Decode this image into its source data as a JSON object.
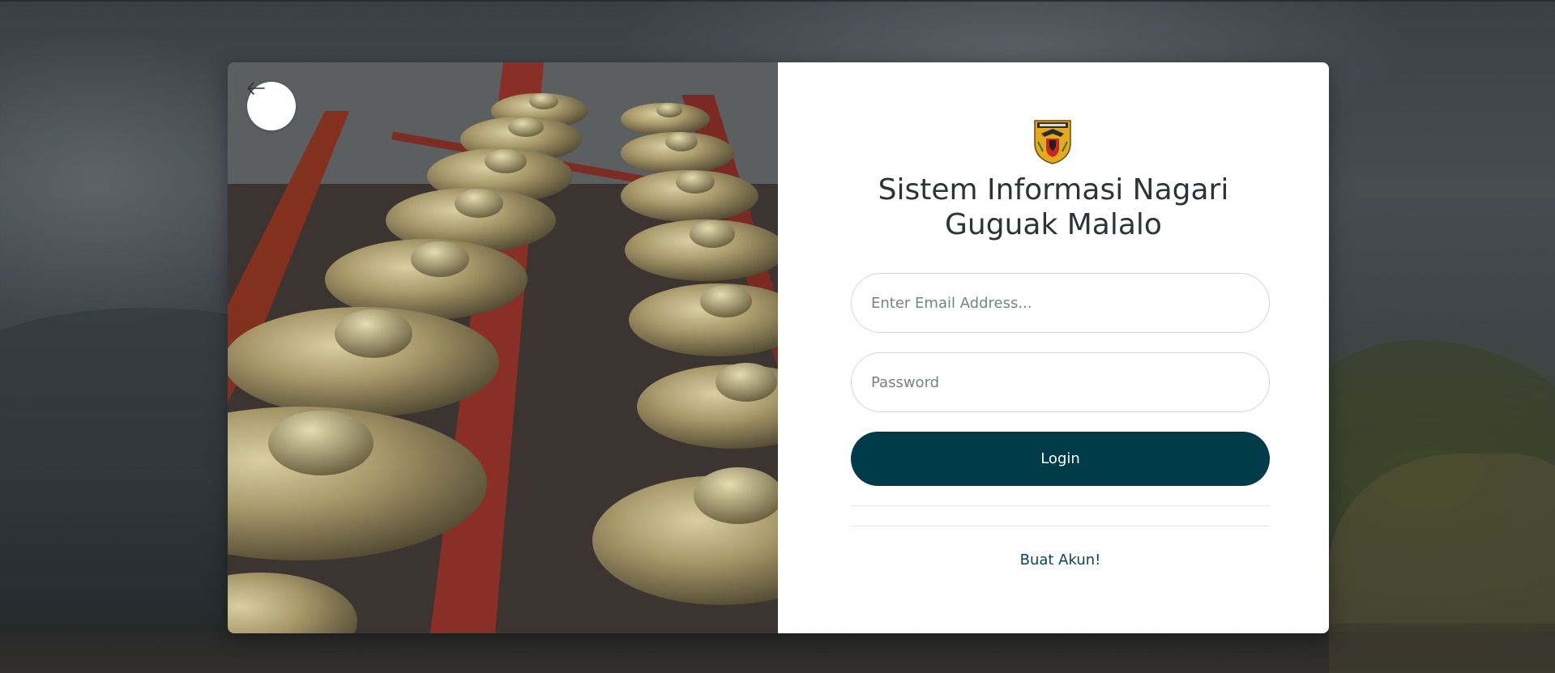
{
  "page": {
    "back_icon": "arrow-left-icon",
    "logo_icon": "regional-crest-icon"
  },
  "login": {
    "title_line1": "Sistem Informasi Nagari",
    "title_line2": "Guguak Malalo",
    "email_placeholder": "Enter Email Address...",
    "email_value": "",
    "password_placeholder": "Password",
    "password_value": "",
    "login_label": "Login",
    "register_label": "Buat Akun!"
  },
  "colors": {
    "primary_button": "#003b4a",
    "link": "#0b4453",
    "title": "#2f3338"
  }
}
